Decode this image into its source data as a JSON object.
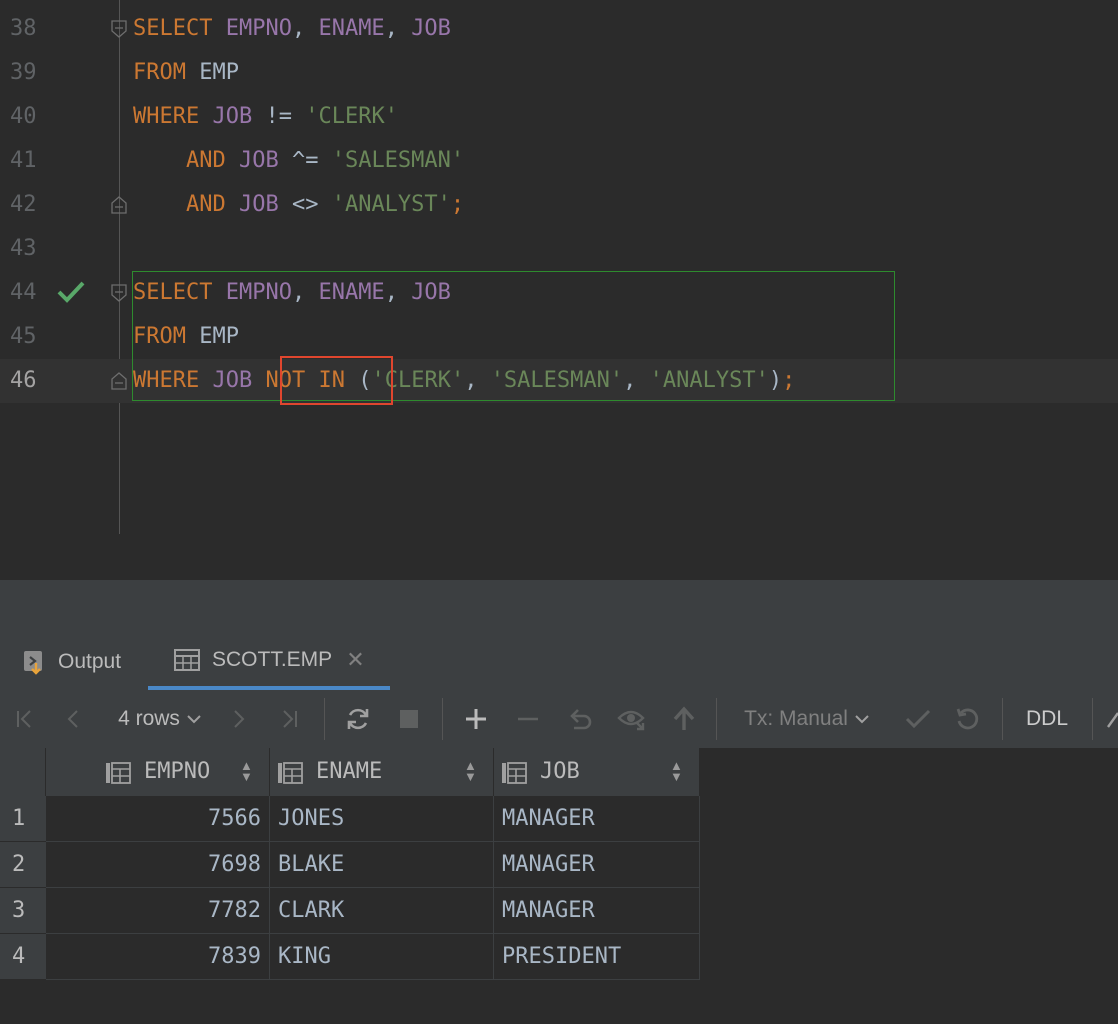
{
  "editor": {
    "lines": [
      {
        "num": "38",
        "tokens": [
          [
            "kw",
            "SELECT "
          ],
          [
            "col",
            "EMPNO"
          ],
          [
            "plain",
            ", "
          ],
          [
            "col",
            "ENAME"
          ],
          [
            "plain",
            ", "
          ],
          [
            "col",
            "JOB"
          ]
        ]
      },
      {
        "num": "39",
        "tokens": [
          [
            "kw",
            "FROM "
          ],
          [
            "plain",
            "EMP"
          ]
        ]
      },
      {
        "num": "40",
        "tokens": [
          [
            "kw",
            "WHERE "
          ],
          [
            "col",
            "JOB"
          ],
          [
            "plain",
            " != "
          ],
          [
            "str",
            "'CLERK'"
          ]
        ]
      },
      {
        "num": "41",
        "tokens": [
          [
            "plain",
            "    "
          ],
          [
            "kw",
            "AND "
          ],
          [
            "col",
            "JOB"
          ],
          [
            "plain",
            " ^= "
          ],
          [
            "str",
            "'SALESMAN'"
          ]
        ]
      },
      {
        "num": "42",
        "tokens": [
          [
            "plain",
            "    "
          ],
          [
            "kw",
            "AND "
          ],
          [
            "col",
            "JOB"
          ],
          [
            "plain",
            " <> "
          ],
          [
            "str",
            "'ANALYST'"
          ],
          [
            "kw",
            ";"
          ]
        ]
      },
      {
        "num": "43",
        "tokens": []
      },
      {
        "num": "44",
        "tokens": [
          [
            "kw",
            "SELECT "
          ],
          [
            "col",
            "EMPNO"
          ],
          [
            "plain",
            ", "
          ],
          [
            "col",
            "ENAME"
          ],
          [
            "plain",
            ", "
          ],
          [
            "col",
            "JOB"
          ]
        ]
      },
      {
        "num": "45",
        "tokens": [
          [
            "kw",
            "FROM "
          ],
          [
            "plain",
            "EMP"
          ]
        ]
      },
      {
        "num": "46",
        "tokens": [
          [
            "kw",
            "WHERE "
          ],
          [
            "col",
            "JOB"
          ],
          [
            "plain",
            " "
          ],
          [
            "kw",
            "NOT IN"
          ],
          [
            "plain",
            " ("
          ],
          [
            "str",
            "'CLERK'"
          ],
          [
            "plain",
            ", "
          ],
          [
            "str",
            "'SALESMAN'"
          ],
          [
            "plain",
            ", "
          ],
          [
            "str",
            "'ANALYST'"
          ],
          [
            "plain",
            ")"
          ],
          [
            "kw",
            ";"
          ]
        ]
      }
    ]
  },
  "tabs": [
    {
      "label": "Output",
      "icon": "output-icon"
    },
    {
      "label": "SCOTT.EMP",
      "icon": "table-icon",
      "close": "✕"
    }
  ],
  "toolbar": {
    "rows_label": "4 rows",
    "tx_label": "Tx: Manual",
    "ddl_label": "DDL"
  },
  "grid": {
    "columns": [
      "EMPNO",
      "ENAME",
      "JOB"
    ],
    "rows": [
      {
        "n": "1",
        "empno": "7566",
        "ename": "JONES",
        "job": "MANAGER"
      },
      {
        "n": "2",
        "empno": "7698",
        "ename": "BLAKE",
        "job": "MANAGER"
      },
      {
        "n": "3",
        "empno": "7782",
        "ename": "CLARK",
        "job": "MANAGER"
      },
      {
        "n": "4",
        "empno": "7839",
        "ename": "KING",
        "job": "PRESIDENT"
      }
    ]
  },
  "colors": {
    "keyword": "#cc7832",
    "identifier": "#9876aa",
    "string": "#6a8759",
    "statement_box": "#2e8b2e",
    "highlight_box": "#e0462e",
    "check": "#59a869"
  }
}
